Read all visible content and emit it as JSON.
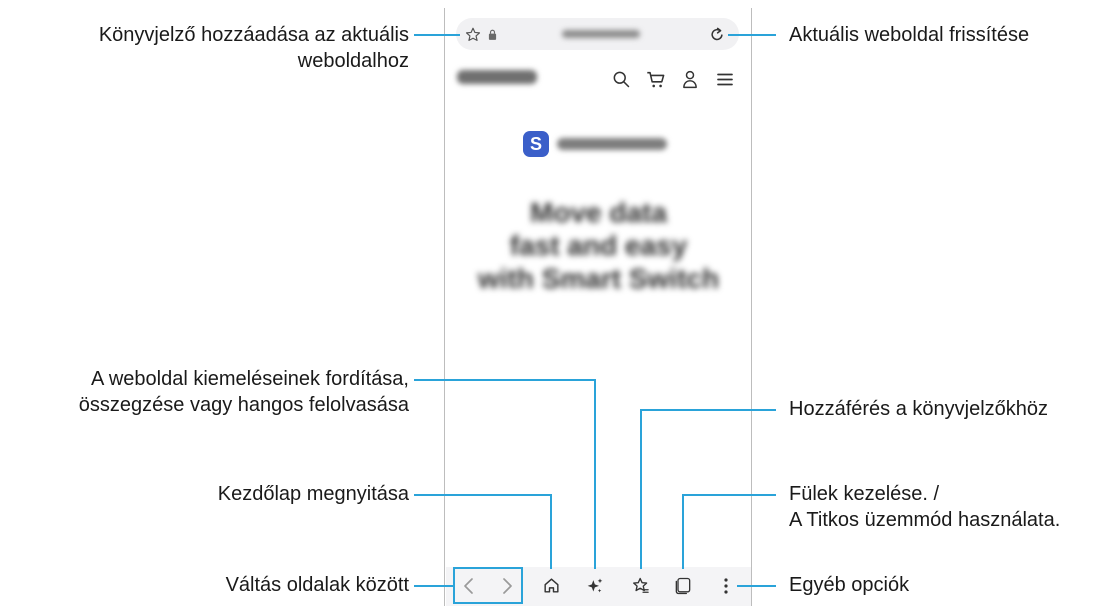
{
  "callouts": {
    "bookmark_add_line1": "Könyvjelző hozzáadása az aktuális",
    "bookmark_add_line2": "weboldalhoz",
    "refresh": "Aktuális weboldal frissítése",
    "translate_line1": "A weboldal kiemeléseinek fordítása,",
    "translate_line2": "összegzése vagy hangos felolvasása",
    "bookmarks_access": "Hozzáférés a könyvjelzőkhöz",
    "home": "Kezdőlap megnyitása",
    "tabs_line1": "Fülek kezelése. /",
    "tabs_line2": "A Titkos üzemmód használata.",
    "navigate": "Váltás oldalak között",
    "more": "Egyéb opciók"
  },
  "page": {
    "logo_letter": "S",
    "headline_line1": "Move data",
    "headline_line2": "fast and easy",
    "headline_line3": "with Smart Switch"
  },
  "icons": {
    "bookmark_star": "star-outline-icon",
    "lock": "lock-icon",
    "refresh": "refresh-icon",
    "search": "search-icon",
    "cart": "cart-icon",
    "account": "person-icon",
    "menu": "hamburger-icon",
    "back": "chevron-left-icon",
    "forward": "chevron-right-icon",
    "home": "home-icon",
    "ai": "sparkle-icon",
    "bookmarks": "star-list-icon",
    "tabs": "tabs-icon",
    "more": "kebab-icon"
  },
  "colors": {
    "accent_line": "#2aa3d9",
    "logo_blue": "#3b5fc9"
  }
}
